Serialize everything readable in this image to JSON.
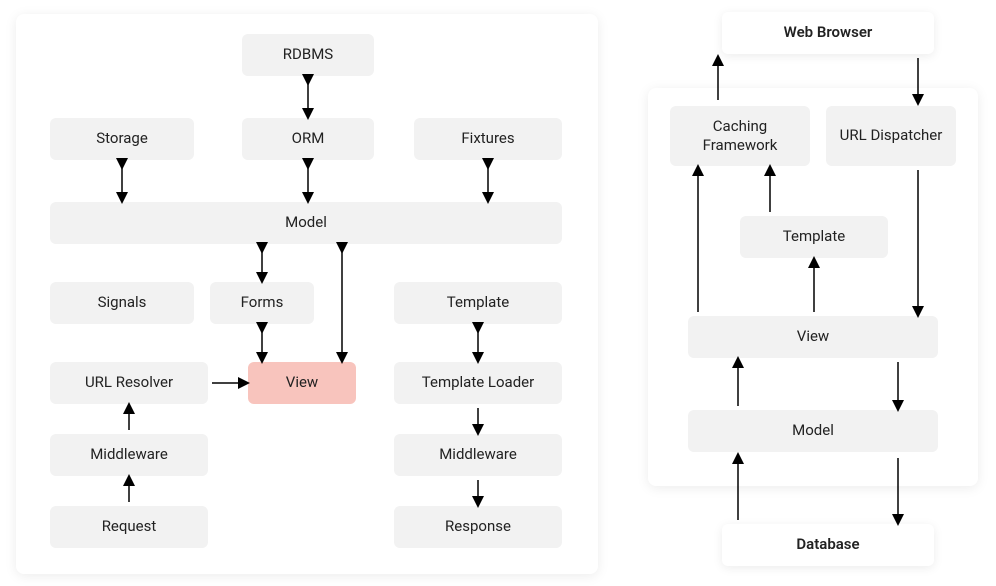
{
  "left": {
    "rdbms": "RDBMS",
    "storage": "Storage",
    "orm": "ORM",
    "fixtures": "Fixtures",
    "model": "Model",
    "signals": "Signals",
    "forms": "Forms",
    "template": "Template",
    "url_resolver": "URL Resolver",
    "view": "View",
    "template_loader": "Template Loader",
    "middleware_left": "Middleware",
    "middleware_right": "Middleware",
    "request": "Request",
    "response": "Response"
  },
  "right": {
    "web_browser": "Web Browser",
    "caching_framework": "Caching Framework",
    "url_dispatcher": "URL Dispatcher",
    "template": "Template",
    "view": "View",
    "model": "Model",
    "database": "Database"
  },
  "colors": {
    "node_bg": "#f2f2f2",
    "highlight_bg": "#f8c4bd",
    "text": "#222222"
  }
}
